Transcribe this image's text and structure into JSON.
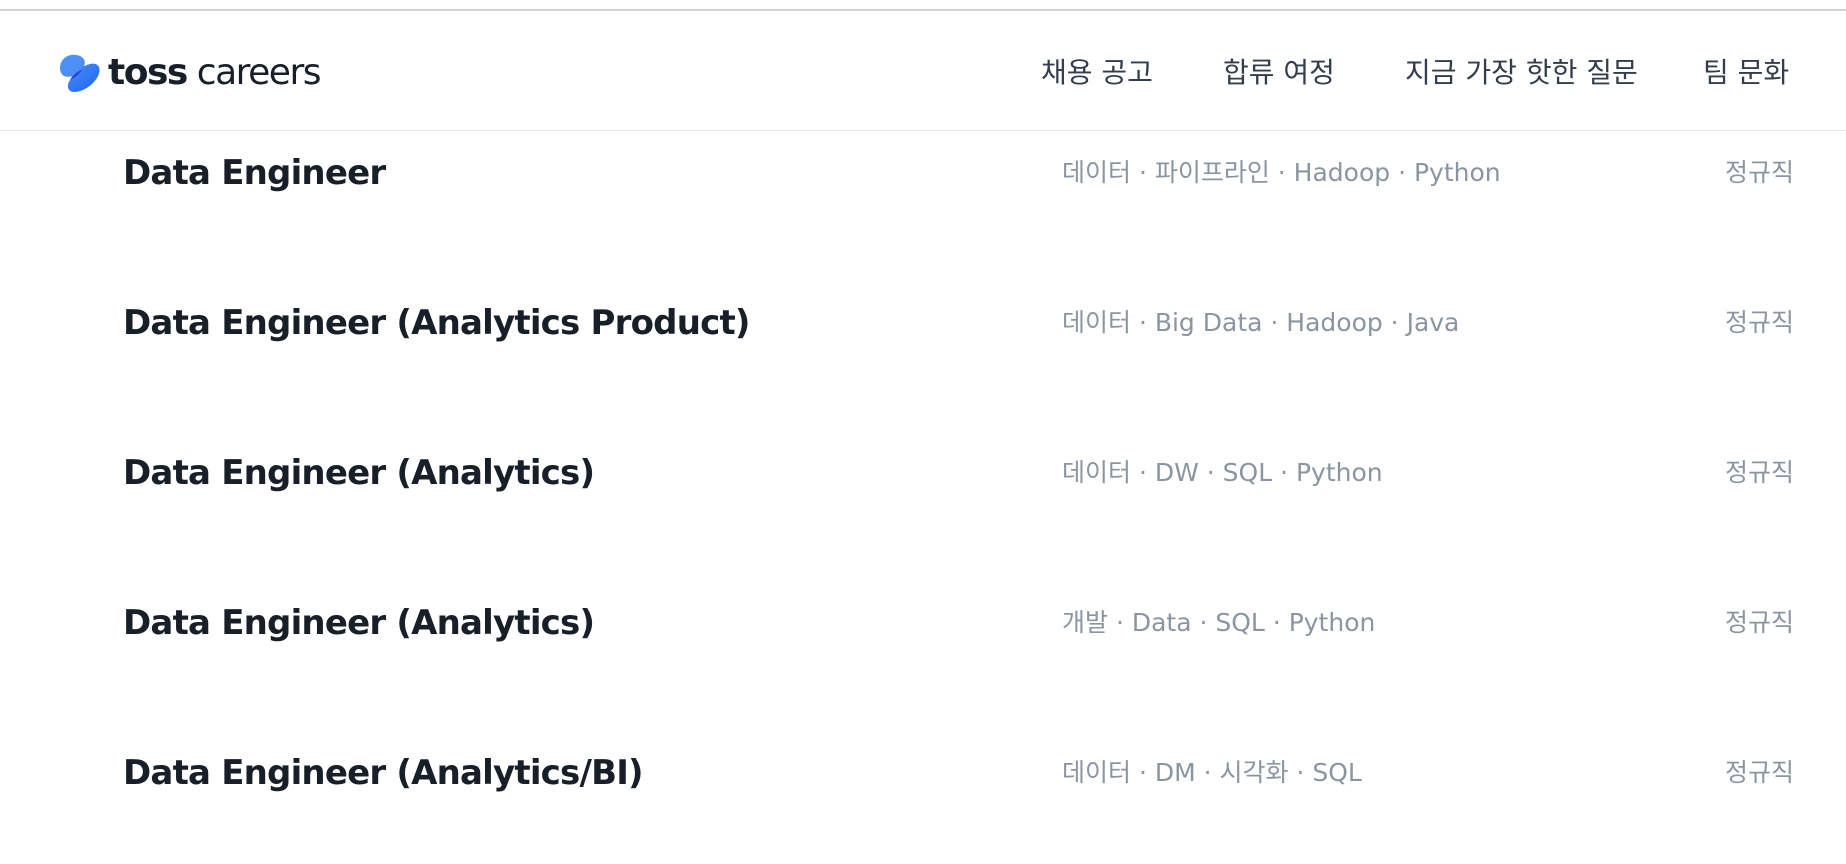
{
  "brand": {
    "logo_text_bold": "toss",
    "logo_text_light": "careers",
    "logo_colors": [
      "#1b64f2",
      "#4d8ef7",
      "#2e3ecf"
    ]
  },
  "nav": {
    "items": [
      {
        "label": "채용 공고"
      },
      {
        "label": "합류 여정"
      },
      {
        "label": "지금 가장 핫한 질문"
      },
      {
        "label": "팀 문화"
      }
    ]
  },
  "jobs": [
    {
      "title": "Data Engineer",
      "tags": "데이터 · 파이프라인 · Hadoop · Python",
      "type": "정규직"
    },
    {
      "title": "Data Engineer (Analytics Product)",
      "tags": "데이터 · Big Data · Hadoop · Java",
      "type": "정규직"
    },
    {
      "title": "Data Engineer (Analytics)",
      "tags": "데이터 · DW · SQL · Python",
      "type": "정규직"
    },
    {
      "title": "Data Engineer (Analytics)",
      "tags": "개발 · Data · SQL · Python",
      "type": "정규직"
    },
    {
      "title": "Data Engineer (Analytics/BI)",
      "tags": "데이터 · DM · 시각화 · SQL",
      "type": "정규직"
    }
  ]
}
